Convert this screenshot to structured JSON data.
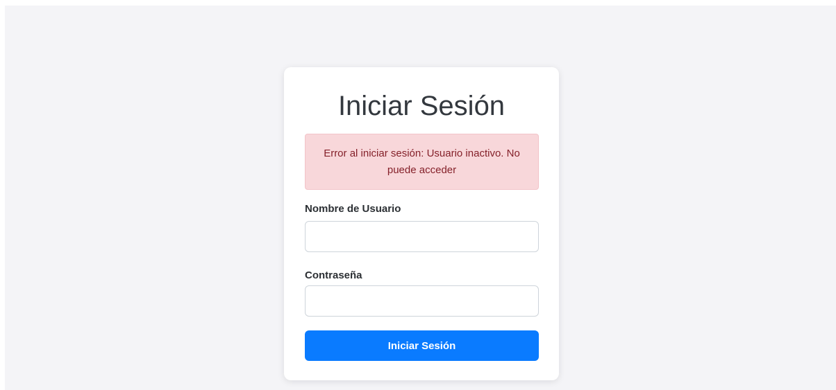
{
  "login": {
    "title": "Iniciar Sesión",
    "error_message": "Error al iniciar sesión: Usuario inactivo. No puede acceder",
    "username_label": "Nombre de Usuario",
    "username_value": "",
    "password_label": "Contraseña",
    "password_value": "",
    "submit_label": "Iniciar Sesión"
  },
  "colors": {
    "background": "#f4f4f7",
    "card": "#ffffff",
    "alert_bg": "#f8d7da",
    "alert_text": "#842029",
    "primary_button": "#0a7bff"
  }
}
